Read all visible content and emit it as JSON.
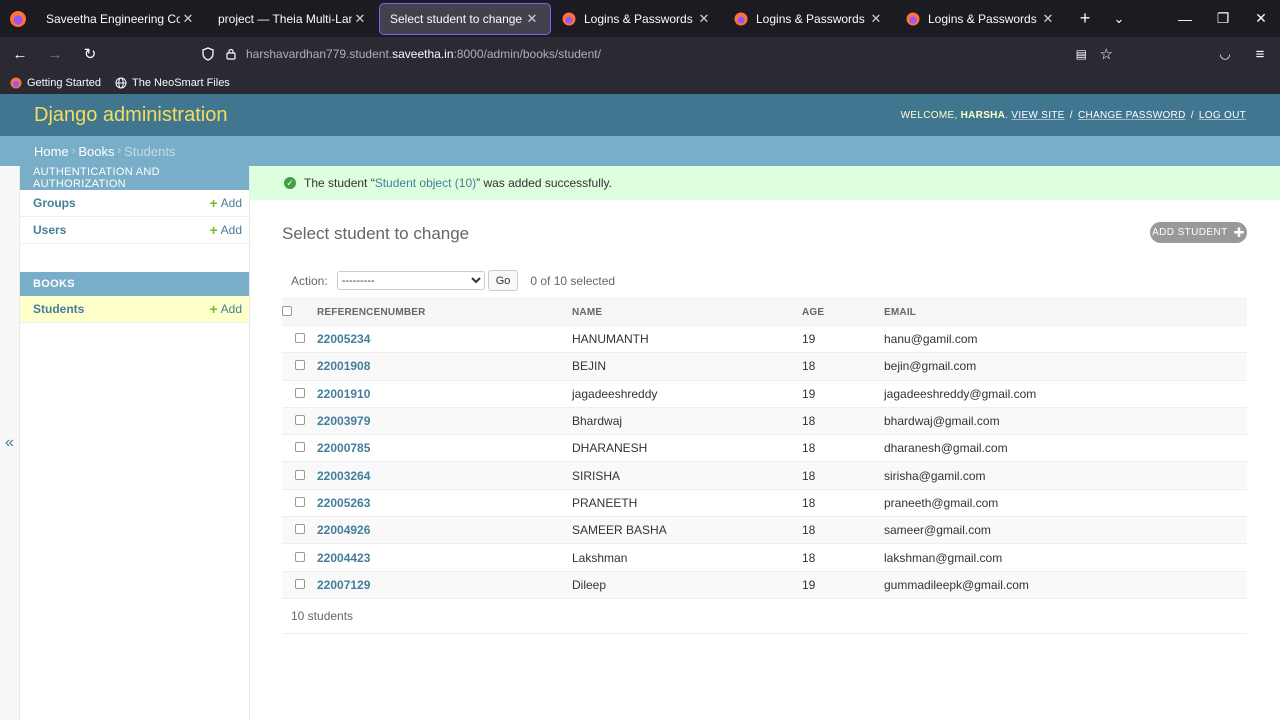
{
  "browser": {
    "tabs": [
      {
        "title": "Saveetha Engineering College",
        "active": false
      },
      {
        "title": "project — Theia Multi-Language",
        "active": false
      },
      {
        "title": "Select student to change | Djang",
        "active": true
      },
      {
        "title": "Logins & Passwords",
        "active": false
      },
      {
        "title": "Logins & Passwords",
        "active": false
      },
      {
        "title": "Logins & Passwords",
        "active": false
      }
    ],
    "url_prefix": "harshavardhan779.student.",
    "url_host": "saveetha.in",
    "url_suffix": ":8000/admin/books/student/",
    "bookmarks": [
      "Getting Started",
      "The NeoSmart Files"
    ]
  },
  "header": {
    "branding": "Django administration",
    "welcome": "Welcome,",
    "username": "Harsha",
    "view_site": "View site",
    "change_password": "Change password",
    "log_out": "Log out"
  },
  "breadcrumbs": {
    "home": "Home",
    "app": "Books",
    "current": "Students"
  },
  "sidebar": {
    "toggle": "«",
    "modules": [
      {
        "caption": "Authentication and Authorization",
        "models": [
          {
            "name": "Groups",
            "add": "Add"
          },
          {
            "name": "Users",
            "add": "Add"
          }
        ]
      },
      {
        "caption": "Books",
        "models": [
          {
            "name": "Students",
            "add": "Add"
          }
        ]
      }
    ]
  },
  "message": {
    "prefix": "The student “",
    "link": "Student object (10)",
    "suffix": "” was added successfully."
  },
  "main": {
    "title": "Select student to change",
    "add_button": "Add student",
    "action_label": "Action:",
    "action_default": "---------",
    "go": "Go",
    "selection_counter": "0 of 10 selected",
    "columns": [
      "Referencenumber",
      "Name",
      "Age",
      "Email"
    ],
    "rows": [
      {
        "ref": "22005234",
        "name": "HANUMANTH",
        "age": "19",
        "email": "hanu@gamil.com"
      },
      {
        "ref": "22001908",
        "name": "BEJIN",
        "age": "18",
        "email": "bejin@gmail.com"
      },
      {
        "ref": "22001910",
        "name": "jagadeeshreddy",
        "age": "19",
        "email": "jagadeeshreddy@gmail.com"
      },
      {
        "ref": "22003979",
        "name": "Bhardwaj",
        "age": "18",
        "email": "bhardwaj@gmail.com"
      },
      {
        "ref": "22000785",
        "name": "DHARANESH",
        "age": "18",
        "email": "dharanesh@gmail.com"
      },
      {
        "ref": "22003264",
        "name": "SIRISHA",
        "age": "18",
        "email": "sirisha@gamil.com"
      },
      {
        "ref": "22005263",
        "name": "PRANEETH",
        "age": "18",
        "email": "praneeth@gmail.com"
      },
      {
        "ref": "22004926",
        "name": "SAMEER BASHA",
        "age": "18",
        "email": "sameer@gmail.com"
      },
      {
        "ref": "22004423",
        "name": "Lakshman",
        "age": "18",
        "email": "lakshman@gmail.com"
      },
      {
        "ref": "22007129",
        "name": "Dileep",
        "age": "19",
        "email": "gummadileepk@gmail.com"
      }
    ],
    "paginator": "10 students"
  },
  "colors": {
    "header_bg": "#417690",
    "branding": "#f5dd5d",
    "breadcrumbs_bg": "#79aec8",
    "link": "#447e9b",
    "success_bg": "#dfd",
    "add_green": "#70bf2b",
    "current_row": "#ffc"
  }
}
